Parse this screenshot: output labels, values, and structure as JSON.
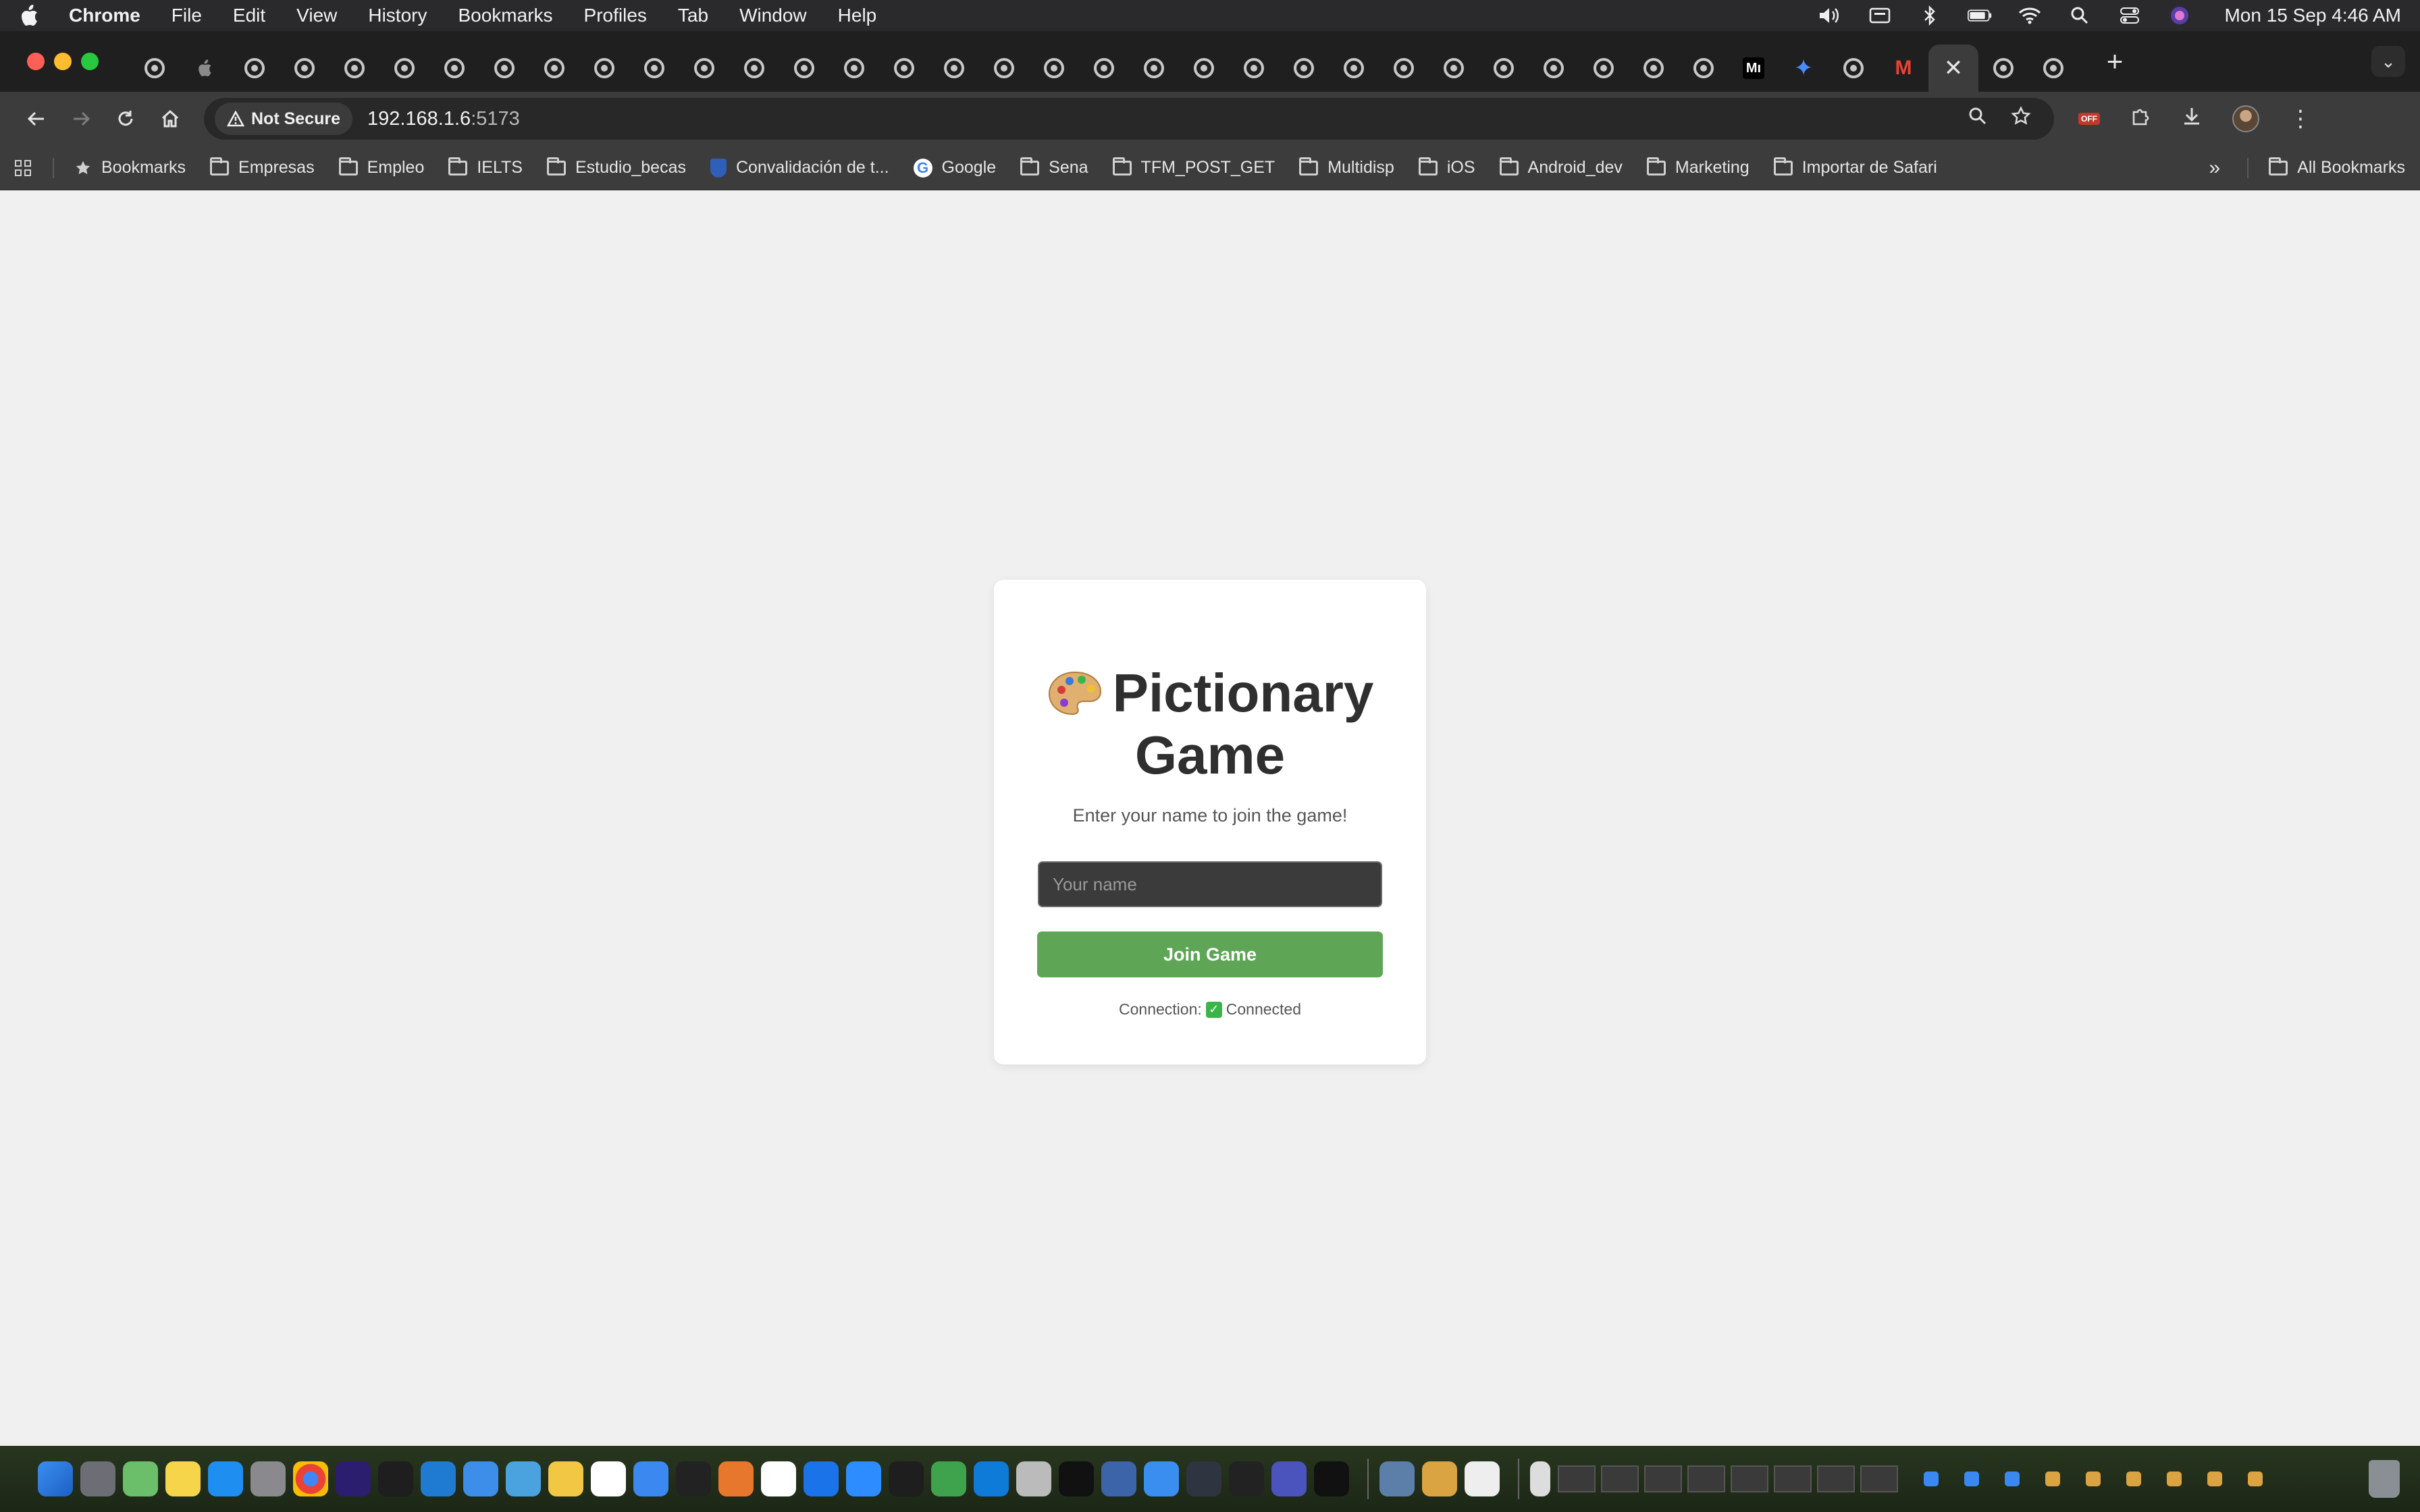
{
  "menubar": {
    "app_name": "Chrome",
    "menus": [
      "File",
      "Edit",
      "View",
      "History",
      "Bookmarks",
      "Profiles",
      "Tab",
      "Window",
      "Help"
    ],
    "clock": "Mon 15 Sep  4:46 AM"
  },
  "tabs": {
    "medium_label": "Mı",
    "close_symbol": "✕",
    "new_tab_symbol": "+",
    "tab_search_symbol": "⌄"
  },
  "toolbar": {
    "security_label": "Not Secure",
    "url_host": "192.168.1.6",
    "url_port": ":5173"
  },
  "bookmarks": {
    "items": [
      {
        "label": "Bookmarks",
        "icon": "star-icon"
      },
      {
        "label": "Empresas",
        "icon": "folder-icon"
      },
      {
        "label": "Empleo",
        "icon": "folder-icon"
      },
      {
        "label": "IELTS",
        "icon": "folder-icon"
      },
      {
        "label": "Estudio_becas",
        "icon": "folder-icon"
      },
      {
        "label": "Convalidación de t...",
        "icon": "shield-icon"
      },
      {
        "label": "Google",
        "icon": "google-icon"
      },
      {
        "label": "Sena",
        "icon": "folder-icon"
      },
      {
        "label": "TFM_POST_GET",
        "icon": "folder-icon"
      },
      {
        "label": "Multidisp",
        "icon": "folder-icon"
      },
      {
        "label": "iOS",
        "icon": "folder-icon"
      },
      {
        "label": "Android_dev",
        "icon": "folder-icon"
      },
      {
        "label": "Marketing",
        "icon": "folder-icon"
      },
      {
        "label": "Importar de Safari",
        "icon": "folder-icon"
      }
    ],
    "more_symbol": "»",
    "all_bookmarks": "All Bookmarks"
  },
  "game": {
    "title": "Pictionary Game",
    "subtitle": "Enter your name to join the game!",
    "name_placeholder": "Your name",
    "name_value": "",
    "join_label": "Join Game",
    "connection_label": "Connection:",
    "connection_status": "Connected",
    "accent_color": "#5ea556"
  }
}
